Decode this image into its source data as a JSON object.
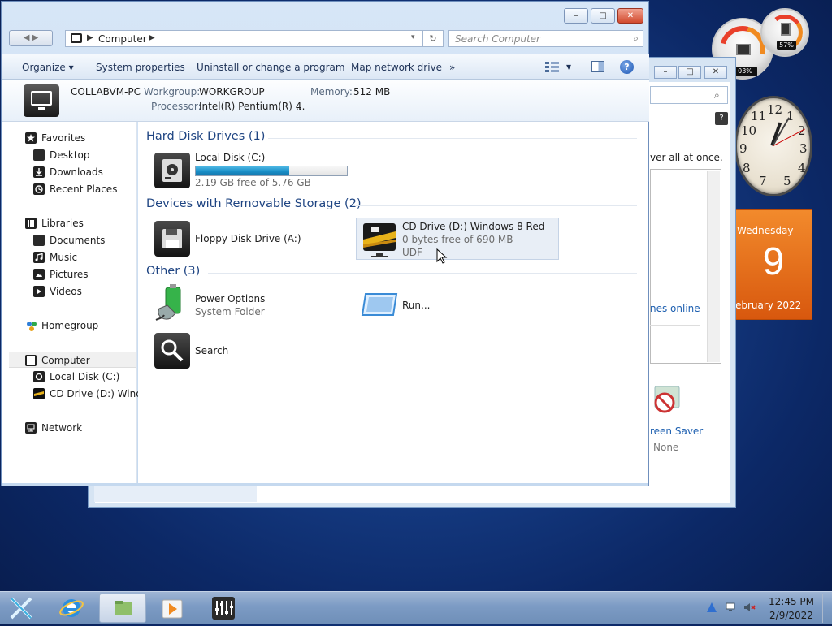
{
  "gadgets": {
    "cpu_percent": "03%",
    "mem_percent": "57%",
    "calendar": {
      "weekday": "Wednesday",
      "day": "9",
      "month_year": "ebruary 2022"
    }
  },
  "background_window": {
    "text_fragment": "ver all at once.",
    "link_fragment": "nes online",
    "screen_saver_label": "reen Saver",
    "screen_saver_value": "None"
  },
  "window": {
    "minimize": "–",
    "maximize": "□",
    "close": "✕",
    "nav_arrows": "◀ ▶",
    "address": {
      "crumb": "Computer",
      "dropdown": "▾",
      "refresh": "↻"
    },
    "search": {
      "placeholder": "Search Computer",
      "icon": "⌕"
    },
    "toolbar": {
      "organize": "Organize ▾",
      "system_properties": "System properties",
      "uninstall": "Uninstall or change a program",
      "map_drive": "Map network drive",
      "more": "»",
      "view_dd": "▾",
      "help": "?"
    },
    "info": {
      "pc_name": "COLLABVM-PC",
      "workgroup_label": "Workgroup:",
      "workgroup": "WORKGROUP",
      "memory_label": "Memory:",
      "memory": "512 MB",
      "processor_label": "Processor:",
      "processor": "Intel(R) Pentium(R) 4",
      "processor_more": "..."
    },
    "nav": {
      "favorites": "Favorites",
      "desktop": "Desktop",
      "downloads": "Downloads",
      "recent": "Recent Places",
      "libraries": "Libraries",
      "documents": "Documents",
      "music": "Music",
      "pictures": "Pictures",
      "videos": "Videos",
      "homegroup": "Homegroup",
      "computer": "Computer",
      "local_disk": "Local Disk (C:)",
      "cd_drive": "CD Drive (D:) Windo",
      "network": "Network"
    },
    "groups": {
      "hdd": "Hard Disk Drives (1)",
      "removable": "Devices with Removable Storage (2)",
      "other": "Other (3)"
    },
    "items": {
      "local_disk": {
        "name": "Local Disk (C:)",
        "free": "2.19 GB free of 5.76 GB",
        "used_fraction": 0.62
      },
      "floppy": {
        "name": "Floppy Disk Drive (A:)"
      },
      "cd": {
        "name": "CD Drive (D:) Windows 8 Red",
        "free": "0 bytes free of 690 MB",
        "fs": "UDF"
      },
      "power": {
        "name": "Power Options",
        "sub": "System Folder"
      },
      "run": {
        "name": "Run..."
      },
      "search": {
        "name": "Search"
      }
    }
  },
  "taskbar": {
    "time": "12:45 PM",
    "date": "2/9/2022"
  },
  "colors": {
    "accent_blue": "#1e4482",
    "taskbar": "#7c9bc4",
    "calendar_orange": "#e46a1a"
  }
}
